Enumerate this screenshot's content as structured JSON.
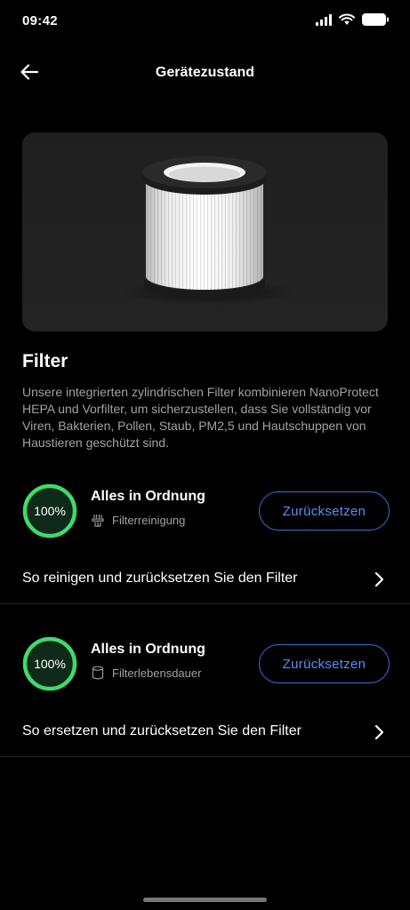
{
  "status_bar": {
    "time": "09:42"
  },
  "header": {
    "title": "Gerätezustand"
  },
  "filter_section": {
    "title": "Filter",
    "description": "Unsere integrierten zylindrischen Filter kombinieren NanoProtect HEPA und Vorfilter, um sicherzustellen, dass Sie vollständig vor Viren, Bakterien, Pollen, Staub, PM2,5 und Hautschuppen von Haustieren geschützt sind."
  },
  "items": [
    {
      "percent_label": "100%",
      "percent_value": 100,
      "status": "Alles in Ordnung",
      "subtitle": "Filterreinigung",
      "icon": "filter-cleaning-icon",
      "button": "Zurücksetzen",
      "link": "So reinigen und zurücksetzen Sie den Filter"
    },
    {
      "percent_label": "100%",
      "percent_value": 100,
      "status": "Alles in Ordnung",
      "subtitle": "Filterlebensdauer",
      "icon": "filter-life-icon",
      "button": "Zurücksetzen",
      "link": "So ersetzen und zurücksetzen Sie den Filter"
    }
  ],
  "colors": {
    "background": "#000000",
    "ring": "#3ddc6a",
    "accent_blue": "#3d6fd9",
    "muted_text": "#a2a2a2"
  }
}
